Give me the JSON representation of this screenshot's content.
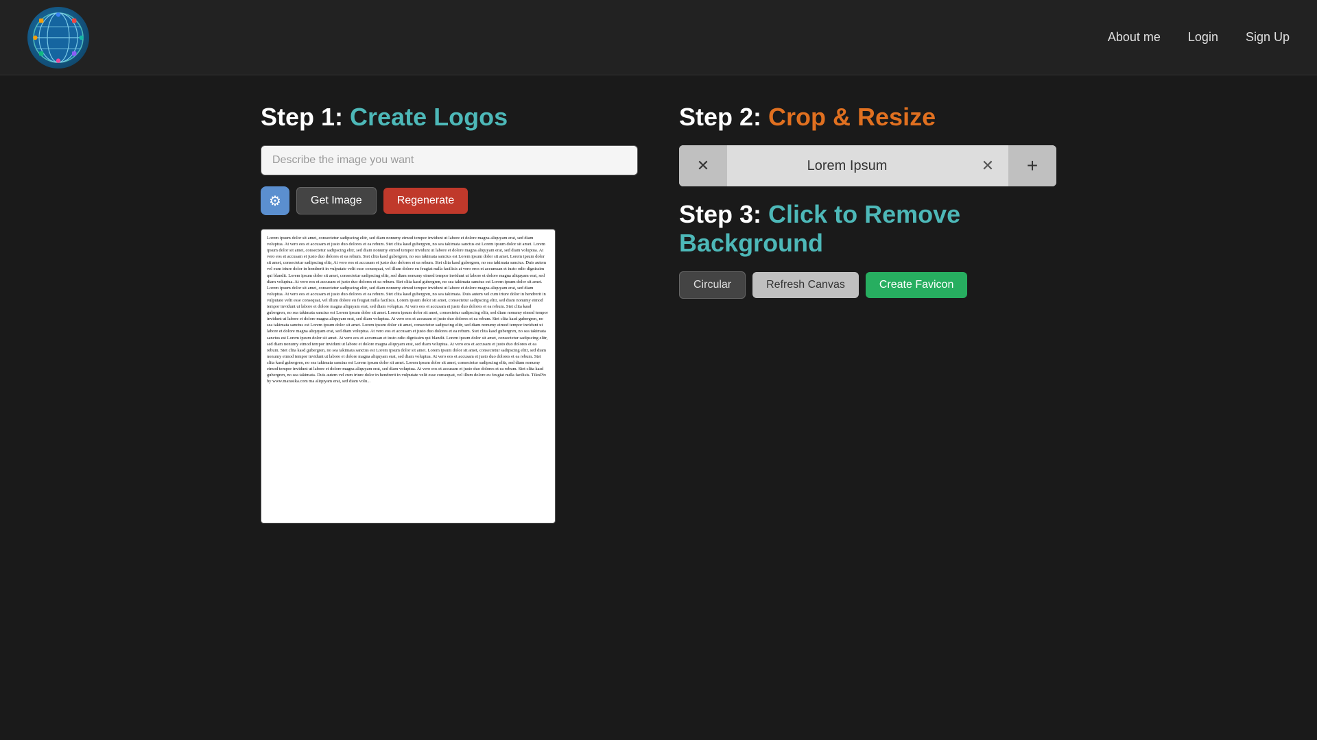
{
  "nav": {
    "logo_alt": "Globe Logo",
    "links": [
      {
        "label": "About me",
        "id": "about-me"
      },
      {
        "label": "Login",
        "id": "login"
      },
      {
        "label": "Sign Up",
        "id": "sign-up"
      }
    ]
  },
  "step1": {
    "heading_number": "Step 1:",
    "heading_title": "Create Logos",
    "search_placeholder": "Describe the image you want",
    "btn_gear_icon": "⚙",
    "btn_get_image": "Get Image",
    "btn_regenerate": "Regenerate"
  },
  "step2": {
    "heading_number": "Step 2:",
    "heading_title": "Crop & Resize",
    "toolbar_close_left": "✕",
    "toolbar_filename": "Lorem Ipsum",
    "toolbar_close_right": "✕",
    "toolbar_add": "+"
  },
  "step3": {
    "heading_number": "Step 3:",
    "heading_title": "Click to Remove Background",
    "btn_circular": "Circular",
    "btn_refresh": "Refresh Canvas",
    "btn_create_favicon": "Create Favicon"
  },
  "lorem_ipsum_short": "Lorem ipsum dolor sit amet, consectetur sadipscing elitr, sed diam nonumy eimod tempor invidunt ut labore et dolore magna aliquyam erat, sed diam voluptua. At vero eos et accusam et justo duo dolores et ea rebum. Stet clita kasd gubergren, no sea takimata sanctus est Lorem ipsum dolor sit amet. Lorem ipsum dolor sit amet, consectetur sadipscing elitr, sed diam nonumy eimod tempor invidunt ut labore et dolore magna aliquyam erat, sed diam voluptua. At vero eos et accusam et justo duo dolores et ea rebum. Stet clita kasd gubergren, no sea takimata sanctus est Lorem ipsum dolor sit amet. Lorem ipsum dolor sit amet, consectetur sadipscing elitr, At vero eos et accusam et justo duo dolores et ea rebum. Stet clita kasd gubergren, no sea takimata sanctus. Duis autem vel eum iriure dolor in hendrerit in vulputate velit esse consequat, vel illum dolore eu feugiat nulla facilisis at vero eros et accumsan et iusto odio dignissim qui blandit. Lorem ipsum dolor sit amet, consectetur sadipscing elitr, sed diam nonumy eimod tempor invidunt ut labore et dolore magna aliquyam erat, sed diam voluptua. At vero eos et accusam et justo duo dolores et ea rebum. Stet clita kasd gubergren, no sea takimata sanctus est Lorem ipsum dolor sit amet. Lorem ipsum dolor sit amet, consectetur sadipscing elitr, sed diam nonumy eimod tempor invidunt ut labore et dolore magna aliquyam erat, sed diam voluptua. At vero eos et accusam et justo duo dolores et ea rebum. Stet clita kasd gubergren, no sea takimata. Duis autem vel cum iriure dolor in hendrerit in vulputate velit esse consequat, vel illum dolore eu feugiat nulla facilisis. Lorem ipsum dolor sit amet, consectetur sadipscing elitr, sed diam nonumy eimod tempor invidunt ut labore et dolore magna aliquyam erat, sed diam voluptua. At vero eos et accusam et justo duo dolores et ea rebum. Stet clita kasd gubergren, no sea takimata sanctus est Lorem ipsum dolor sit amet. Lorem ipsum dolor sit amet, consectetur sadipscing elitr, sed diam nonumy eimod tempor invidunt ut labore et dolore magna aliquyam erat, sed diam voluptua. At vero eos et accusam et justo duo dolores et ea rebum. Stet clita kasd gubergren, no sea takimata sanctus est Lorem ipsum dolor sit amet. Lorem ipsum dolor sit amet, consectetur sadipscing elitr, sed diam nonumy eimod tempor invidunt ut labore et dolore magna aliquyam erat, sed diam voluptua. At vero eos et accusam et justo duo dolores et ea rebum. Stet clita kasd gubergren, no sea takimata sanctus est Lorem ipsum dolor sit amet. At vero eos et accumsan et iusto odio dignissim qui blandit. Lorem ipsum dolor sit amet, consectetur sadipscing elitr, sed diam nonumy eimod tempor invidunt ut labore et dolore magna aliquyam erat, sed diam voluptua. At vero eos et accusam et justo duo dolores et ea rebum. Stet clita kasd gubergren, no sea takimata sanctus est Lorem ipsum dolor sit amet. Lorem ipsum dolor sit amet, consectetur sadipscing elitr, sed diam nonumy eimod tempor invidunt ut labore et dolore magna aliquyam erat, sed diam voluptua. At vero eos et accusam et justo duo dolores et ea rebum. Stet clita kasd gubergren, no sea takimata sanctus est Lorem ipsum dolor sit amet. Lorem ipsum dolor sit amet, consectetur sadipscing elitr, sed diam nonumy eimod tempor invidunt ut labore et dolore magna aliquyam erat, sed diam voluptua. At vero eos et accusam et justo duo dolores et ea rebum. Stet clita kasd gubergren, no sea takimata. Duis autem vel cum iriure dolor in hendrerit in vulputate velit esse consequat, vel illum dolore eu feugiat nulla facilisis. TilesPix by www.marasika.com ma aliquyam erat, sed diam volu..."
}
